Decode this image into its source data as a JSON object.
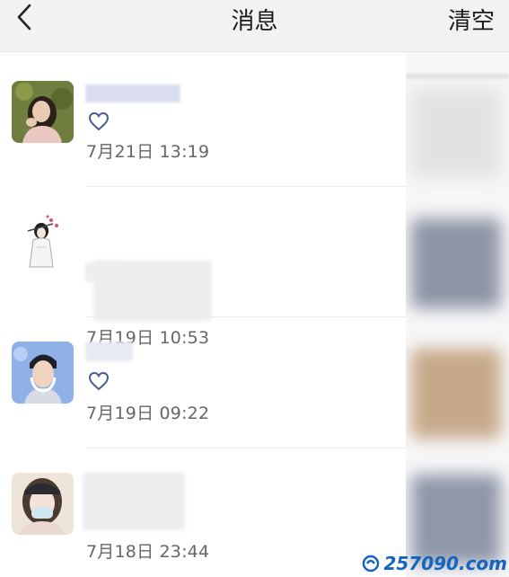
{
  "header": {
    "title": "消息",
    "clear_label": "清空",
    "back_icon": "chevron-left-icon"
  },
  "messages": [
    {
      "time": "7月21日 13:19",
      "has_heart": true
    },
    {
      "time": "7月19日 10:53",
      "has_heart": false
    },
    {
      "time": "7月19日 09:22",
      "has_heart": true
    },
    {
      "time": "7月18日 23:44",
      "has_heart": false
    }
  ],
  "watermark": {
    "text": "257090.com",
    "color": "#1565c0"
  },
  "colors": {
    "header_bg": "#f2f2f2",
    "heart": "#4a5a8a",
    "time_text": "#666666"
  }
}
